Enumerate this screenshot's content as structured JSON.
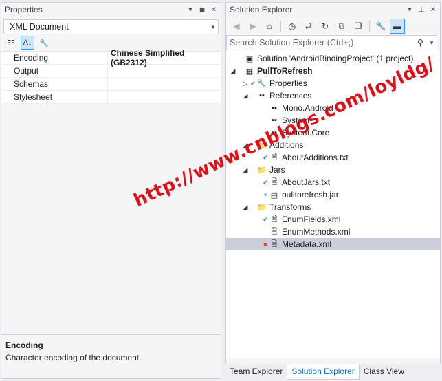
{
  "properties": {
    "title": "Properties",
    "title_buttons": [
      "▾",
      "◼",
      "✕"
    ],
    "object_selector": "XML Document",
    "toolbar": {
      "categorized": "☷",
      "alphabetical": "A↓",
      "property_pages": "🔧"
    },
    "rows": [
      {
        "name": "Encoding",
        "value": "Chinese Simplified (GB2312)"
      },
      {
        "name": "Output",
        "value": ""
      },
      {
        "name": "Schemas",
        "value": ""
      },
      {
        "name": "Stylesheet",
        "value": ""
      }
    ],
    "description": {
      "title": "Encoding",
      "text": "Character encoding of the document."
    }
  },
  "solution_explorer": {
    "title": "Solution Explorer",
    "title_buttons": [
      "▾",
      "⊥",
      "✕"
    ],
    "search_placeholder": "Search Solution Explorer (Ctrl+;)",
    "tree": [
      {
        "label": "Solution 'AndroidBindingProject' (1 project)",
        "level": 0,
        "arrow": "",
        "badge": "",
        "icon": "▣",
        "bold": false
      },
      {
        "label": "PullToRefresh",
        "level": 0,
        "arrow": "◢",
        "badge": "",
        "icon": "▦",
        "bold": true
      },
      {
        "label": "Properties",
        "level": 1,
        "arrow": "▷",
        "badge": "✔",
        "icon": "🔧",
        "bold": false
      },
      {
        "label": "References",
        "level": 1,
        "arrow": "◢",
        "badge": "",
        "icon": "▪▪",
        "bold": false
      },
      {
        "label": "Mono.Android",
        "level": 2,
        "arrow": "",
        "badge": "",
        "icon": "▪▪",
        "bold": false
      },
      {
        "label": "System",
        "level": 2,
        "arrow": "",
        "badge": "",
        "icon": "▪▪",
        "bold": false
      },
      {
        "label": "System.Core",
        "level": 2,
        "arrow": "",
        "badge": "",
        "icon": "▪▪",
        "bold": false
      },
      {
        "label": "Additions",
        "level": 1,
        "arrow": "◢",
        "badge": "",
        "icon": "📁",
        "bold": false
      },
      {
        "label": "AboutAdditions.txt",
        "level": 2,
        "arrow": "",
        "badge": "✔",
        "icon": "🗎",
        "bold": false
      },
      {
        "label": "Jars",
        "level": 1,
        "arrow": "◢",
        "badge": "",
        "icon": "📁",
        "bold": false
      },
      {
        "label": "AboutJars.txt",
        "level": 2,
        "arrow": "",
        "badge": "✔",
        "icon": "🗎",
        "bold": false
      },
      {
        "label": "pulltorefresh.jar",
        "level": 2,
        "arrow": "",
        "badge": "+",
        "icon": "▤",
        "bold": false
      },
      {
        "label": "Transforms",
        "level": 1,
        "arrow": "◢",
        "badge": "",
        "icon": "📁",
        "bold": false
      },
      {
        "label": "EnumFields.xml",
        "level": 2,
        "arrow": "",
        "badge": "✔",
        "icon": "🗎",
        "bold": false
      },
      {
        "label": "EnumMethods.xml",
        "level": 2,
        "arrow": "",
        "badge": "",
        "icon": "🗎",
        "bold": false
      },
      {
        "label": "Metadata.xml",
        "level": 2,
        "arrow": "",
        "badge": "■",
        "icon": "🗎",
        "bold": false,
        "selected": true
      }
    ],
    "tabs": [
      "Team Explorer",
      "Solution Explorer",
      "Class View"
    ],
    "active_tab": 1
  },
  "watermark": "http://www.cnblogs.com/loyldg/",
  "colors": {
    "selection": "#cccedb",
    "accent_blue": "#0e70c0",
    "watermark_red": "#e0101a"
  }
}
